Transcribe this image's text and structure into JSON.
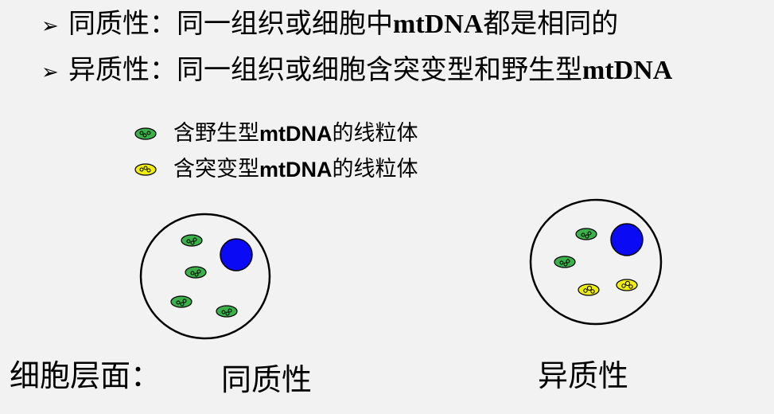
{
  "bullets": [
    {
      "icon": "arrow-bullet-icon",
      "prefix": "同质性：同一组织或细胞中",
      "bold": "mtDNA",
      "suffix": "都是相同的"
    },
    {
      "icon": "arrow-bullet-icon",
      "prefix": "异质性：同一组织或细胞含突变型和野生型",
      "bold": "mtDNA",
      "suffix": ""
    }
  ],
  "legend": [
    {
      "icon": "wildtype-mitochondrion-icon",
      "color": "#3cb04a",
      "prefix": "含野生型",
      "bold": "mtDNA",
      "suffix": "的线粒体"
    },
    {
      "icon": "mutant-mitochondrion-icon",
      "color": "#f0ee10",
      "prefix": "含突变型",
      "bold": "mtDNA",
      "suffix": "的线粒体"
    }
  ],
  "colors": {
    "nucleus": "#0a0af5",
    "wildtype": "#3cb04a",
    "mutant": "#f0ee10",
    "background": "#f2f2f2"
  },
  "captions": {
    "level": "细胞层面：",
    "homoplasmy": "同质性",
    "heteroplasmy": "异质性"
  }
}
